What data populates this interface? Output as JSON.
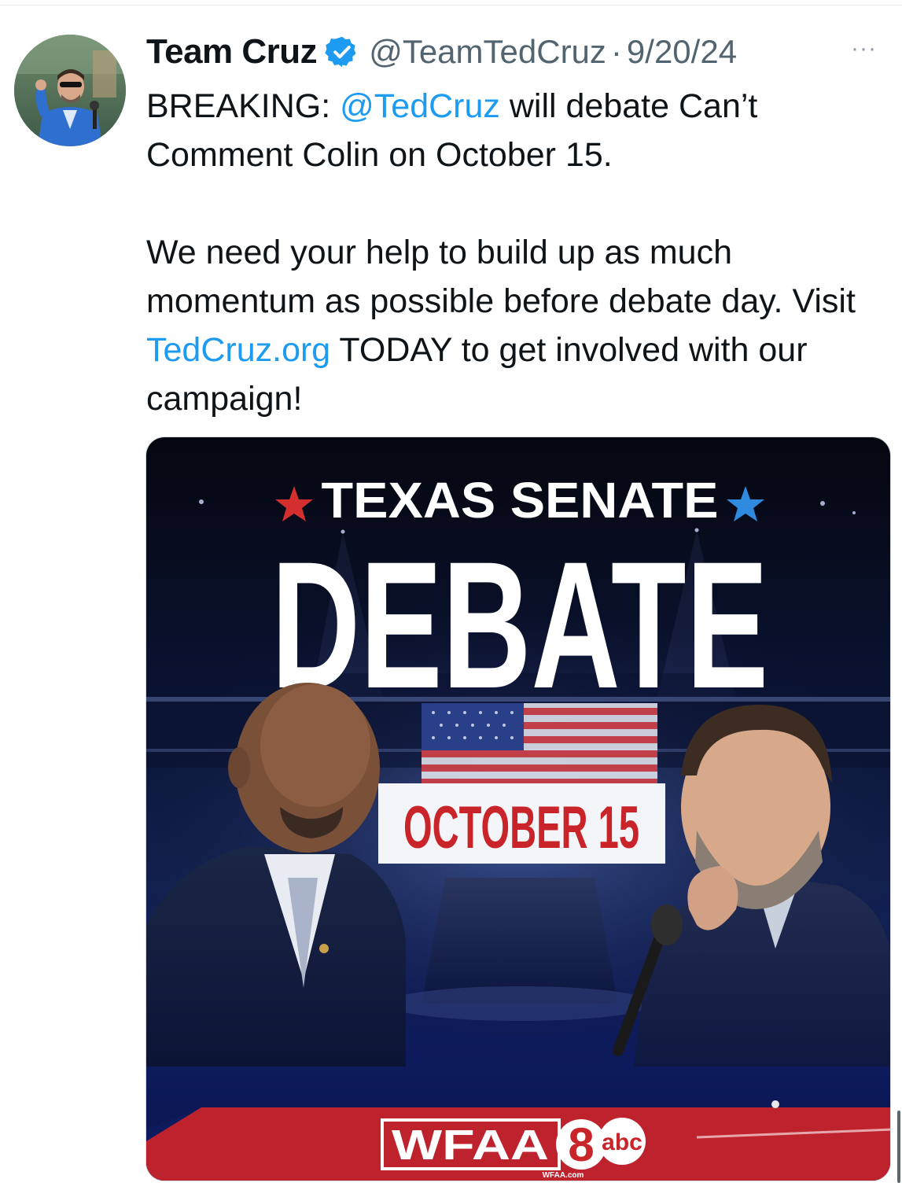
{
  "tweet": {
    "author_name": "Team Cruz",
    "handle": "@TeamTedCruz",
    "separator": "·",
    "date": "9/20/24",
    "more_label": "···",
    "text": {
      "p1_prefix": "BREAKING: ",
      "p1_mention": "@TedCruz",
      "p1_suffix": " will debate Can’t Comment Colin on October 15.",
      "p2_prefix": "We need your help to build up as much momentum as possible before debate day. Visit ",
      "p2_link": "TedCruz.org",
      "p2_suffix": " TODAY to get involved with our campaign!"
    }
  },
  "media": {
    "line1": "TEXAS SENATE",
    "line2": "DEBATE",
    "date_banner": "OCTOBER 15",
    "broadcaster_logo": "WFAA",
    "channel_number": "8",
    "network_logo": "abc",
    "site": "WFAA.com"
  },
  "colors": {
    "link": "#1d9bf0",
    "verified": "#1d9bf0",
    "banner_red": "#c8242a",
    "star_red": "#d32f2f",
    "star_blue": "#2f8be0",
    "navy": "#0d1a5c"
  },
  "icons": {
    "verified": "verified-badge-icon",
    "more": "more-options-icon"
  }
}
